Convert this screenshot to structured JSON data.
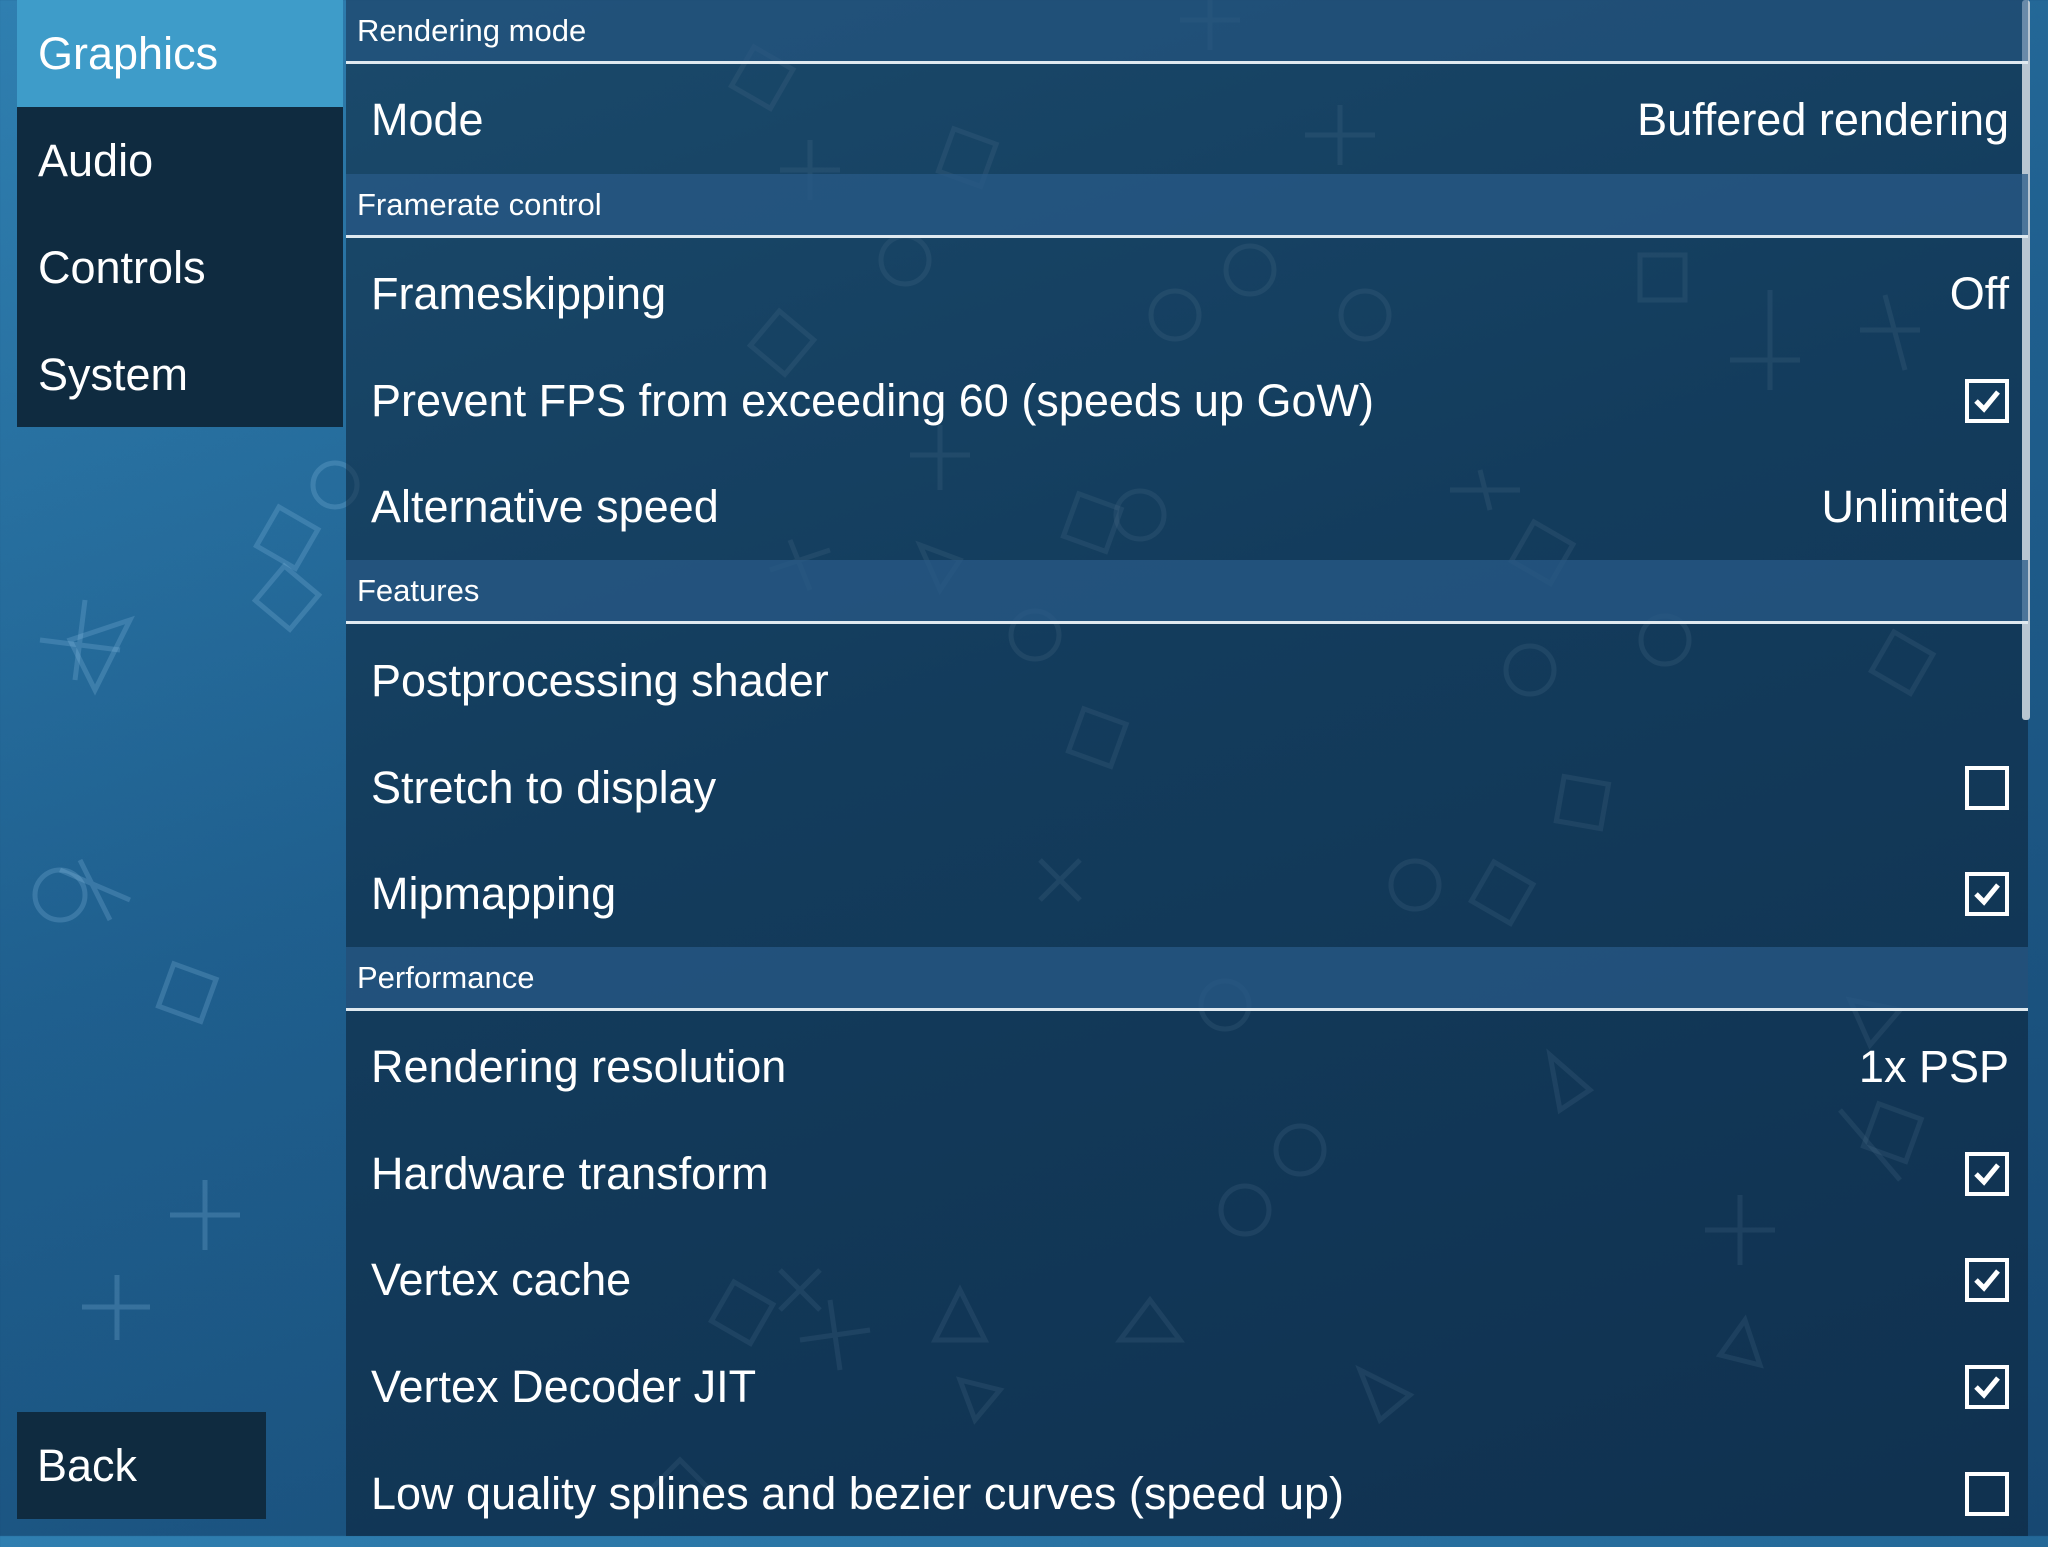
{
  "sidebar": {
    "tabs": [
      {
        "label": "Graphics",
        "active": true
      },
      {
        "label": "Audio",
        "active": false
      },
      {
        "label": "Controls",
        "active": false
      },
      {
        "label": "System",
        "active": false
      }
    ],
    "back_label": "Back"
  },
  "sections": {
    "rendering_mode": {
      "header": "Rendering mode",
      "mode": {
        "label": "Mode",
        "value": "Buffered rendering"
      }
    },
    "framerate_control": {
      "header": "Framerate control",
      "frameskipping": {
        "label": "Frameskipping",
        "value": "Off"
      },
      "prevent_fps": {
        "label": "Prevent FPS from exceeding 60 (speeds up GoW)",
        "checked": true
      },
      "alternative_speed": {
        "label": "Alternative speed",
        "value": "Unlimited"
      }
    },
    "features": {
      "header": "Features",
      "postprocessing_shader": {
        "label": "Postprocessing shader",
        "value": ""
      },
      "stretch_to_display": {
        "label": "Stretch to display",
        "checked": false
      },
      "mipmapping": {
        "label": "Mipmapping",
        "checked": true
      }
    },
    "performance": {
      "header": "Performance",
      "rendering_resolution": {
        "label": "Rendering resolution",
        "value": "1x PSP"
      },
      "hardware_transform": {
        "label": "Hardware transform",
        "checked": true
      },
      "vertex_cache": {
        "label": "Vertex cache",
        "checked": true
      },
      "vertex_decoder_jit": {
        "label": "Vertex Decoder JIT",
        "checked": true
      },
      "low_quality_splines": {
        "label": "Low quality splines and bezier curves (speed up)",
        "checked": false
      }
    }
  },
  "colors": {
    "background": "#2a73a6",
    "tab_bg": "#0f2b40",
    "tab_active": "#3e9cc9"
  }
}
